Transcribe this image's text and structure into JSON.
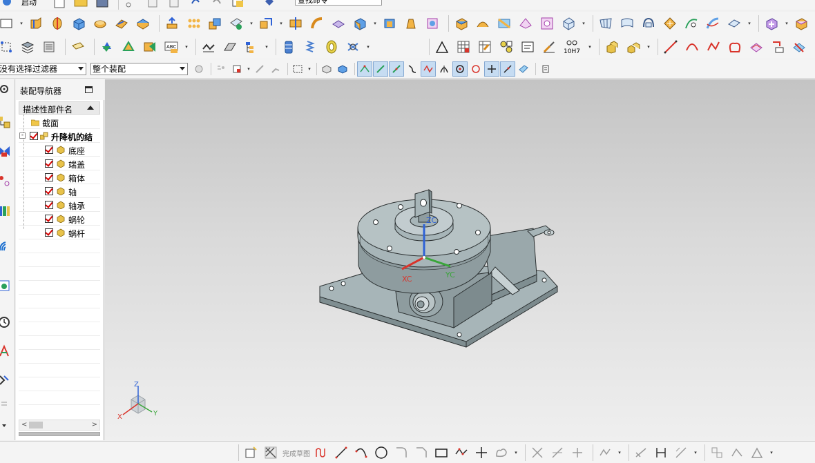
{
  "toolbar_top": {
    "label_fragment": "启动",
    "command_finder_value": "查找命令"
  },
  "selection_bar": {
    "filter_value": "没有选择过滤器",
    "scope_value": "整个装配"
  },
  "navigator": {
    "title": "装配导航器",
    "column_header": "描述性部件名",
    "section_node": "截面",
    "root_assembly": "升降机的结",
    "parts": [
      "底座",
      "端盖",
      "箱体",
      "轴",
      "轴承",
      "蜗轮",
      "蜗杆"
    ]
  },
  "viewport": {
    "wcs_labels": {
      "z": "ZC",
      "y": "YC",
      "x": "XC"
    },
    "triad_labels": {
      "z": "Z",
      "y": "Y",
      "x": "X"
    }
  },
  "bottom_toolbar": {
    "finish_sketch_label": "完成草图"
  },
  "toolbar_labels": {
    "fit_label": "10H7"
  },
  "colors": {
    "model_body": "#93a3a6",
    "model_edge": "#2a2f30",
    "x_axis": "#d9342b",
    "y_axis": "#3aa53a",
    "z_axis": "#2f62d6",
    "check_red": "#d40000"
  }
}
